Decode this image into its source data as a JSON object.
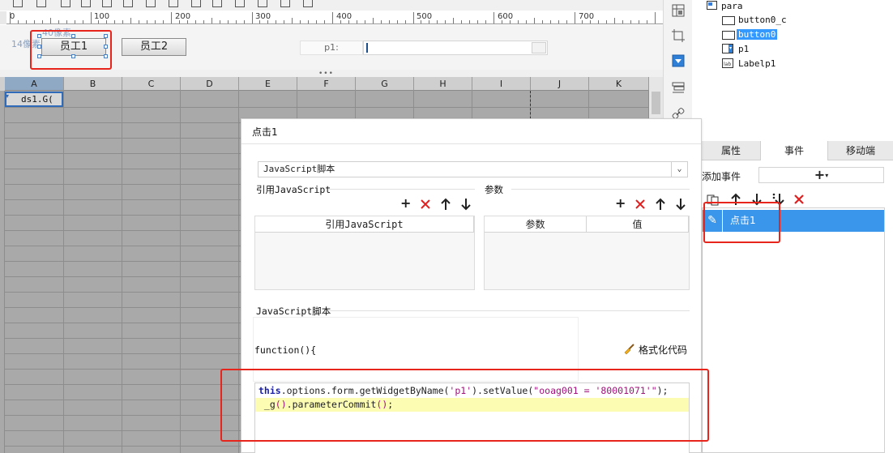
{
  "ruler": {
    "marks": [
      "0",
      "100",
      "200",
      "300",
      "400",
      "500",
      "600",
      "700"
    ]
  },
  "param_pane": {
    "emp_buttons": [
      {
        "label": "员工1"
      },
      {
        "label": "员工2"
      }
    ],
    "size_labels": {
      "height": "40像素",
      "width": "14像素"
    },
    "p1_label": "p1:"
  },
  "sheet": {
    "columns": [
      "A",
      "B",
      "C",
      "D",
      "E",
      "F",
      "G",
      "H",
      "I",
      "J",
      "K"
    ],
    "cell_a1": "ds1.G("
  },
  "tree": {
    "root": "para",
    "items": [
      {
        "label": "button0_c",
        "icon": "button-icon"
      },
      {
        "label": "button0",
        "icon": "button-icon",
        "selected": true
      },
      {
        "label": "p1",
        "icon": "combo-icon"
      },
      {
        "label": "Labelp1",
        "icon": "label-icon"
      }
    ]
  },
  "right_panel": {
    "tabs": [
      "属性",
      "事件",
      "移动端"
    ],
    "active_tab": "事件",
    "add_event_label": "添加事件",
    "add_event_symbol": "+",
    "events": [
      {
        "name": "点击1"
      }
    ]
  },
  "dialog": {
    "title": "点击1",
    "script_type": "JavaScript脚本",
    "ref_section_label": "引用JavaScript",
    "ref_table_header": "引用JavaScript",
    "param_section_label": "参数",
    "param_table_headers": [
      "参数",
      "值"
    ],
    "script_section_label": "JavaScript脚本",
    "function_head": "function(){",
    "format_label": "格式化代码",
    "code": {
      "line1": {
        "kw": "this",
        "part_a": ".options.form.getWidgetByName(",
        "str1": "'p1'",
        "part_b": ").setValue(",
        "str2": "\"ooag001 = '80001071'\"",
        "part_c": ");"
      },
      "line2": {
        "prefix": " _g",
        "parens": "()",
        "rest": ".parameterCommit",
        "end_parens": "()",
        "semi": ";"
      }
    }
  },
  "colors": {
    "accent": "#3a96ea",
    "annotation_red": "#e8251d",
    "selected_column": "#8fa8c3",
    "sheet_bg": "#a9a9a9",
    "code_highlight": "#fdfcb3",
    "keyword": "#1b1fa0",
    "string": "#a1127a"
  }
}
